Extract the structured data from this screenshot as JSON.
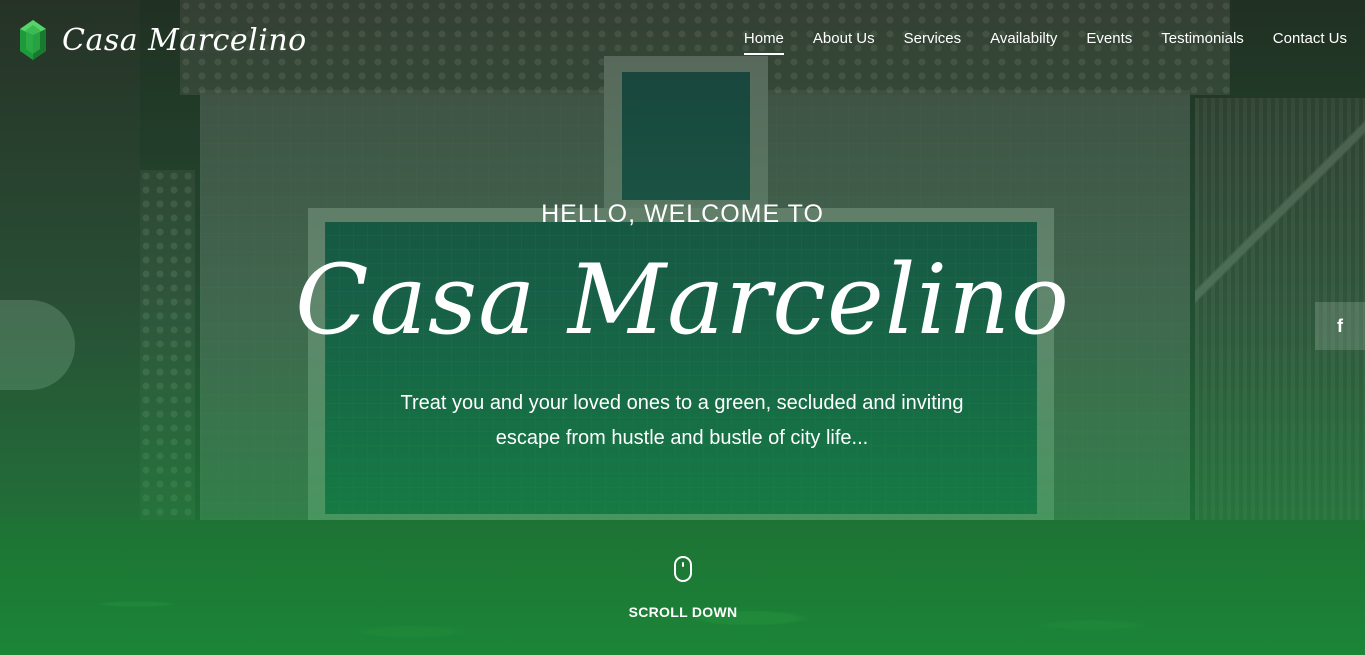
{
  "brand": {
    "name": "Casa Marcelino",
    "logo_icon": "emerald-gem-icon",
    "gem_color": "#2fb24a"
  },
  "nav": {
    "items": [
      {
        "label": "Home",
        "active": true
      },
      {
        "label": "About Us"
      },
      {
        "label": "Services"
      },
      {
        "label": "Availabilty"
      },
      {
        "label": "Events"
      },
      {
        "label": "Testimonials"
      },
      {
        "label": "Contact Us"
      }
    ]
  },
  "hero": {
    "greeting": "HELLO, WELCOME TO",
    "title": "Casa Marcelino",
    "tagline_line1": "Treat you and your loved ones to a green, secluded and inviting",
    "tagline_line2": "escape from hustle and bustle of city life...",
    "scroll_label": "SCROLL DOWN",
    "scroll_icon": "mouse-icon"
  },
  "social": {
    "facebook_icon": "facebook-icon",
    "facebook_glyph": "f"
  },
  "colors": {
    "overlay_green": "#16963c",
    "text": "#ffffff"
  }
}
